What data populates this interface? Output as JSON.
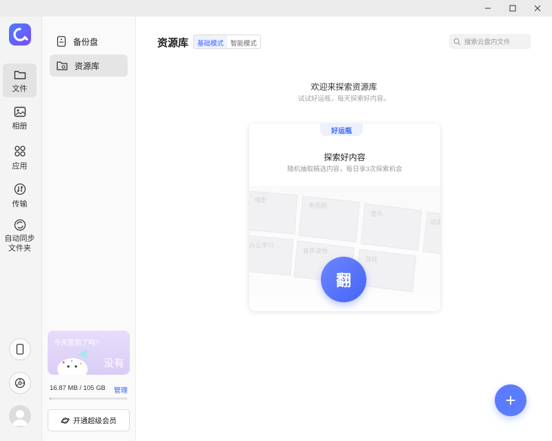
{
  "window": {
    "min_icon": "minimize-icon",
    "max_icon": "maximize-icon",
    "close_icon": "close-icon"
  },
  "rail": {
    "items": [
      {
        "label": "文件",
        "icon": "folder-icon",
        "active": true
      },
      {
        "label": "相册",
        "icon": "photo-icon"
      },
      {
        "label": "应用",
        "icon": "apps-icon"
      },
      {
        "label": "传输",
        "icon": "transfer-icon"
      },
      {
        "label": "自动同步\n文件夹",
        "icon": "sync-icon"
      }
    ]
  },
  "sidebar": {
    "items": [
      {
        "label": "备份盘",
        "icon": "backup-drive-icon"
      },
      {
        "label": "资源库",
        "icon": "library-folder-icon",
        "active": true
      }
    ],
    "promo": {
      "text": "今天签到了吗?",
      "badge": "没有"
    },
    "storage": {
      "text": "16.87 MB / 105 GB",
      "manage": "管理",
      "used_fraction": 0.0002
    },
    "vip_button": "开通超级会员"
  },
  "main": {
    "title": "资源库",
    "modes": [
      "基础模式",
      "智能模式"
    ],
    "search_placeholder": "搜索云盘内文件",
    "welcome_title": "欢迎来探索资源库",
    "welcome_sub": "试试好运瓶，每天探索好内容。",
    "card": {
      "tag": "好运瓶",
      "title": "探索好内容",
      "subtitle": "随机抽取精选内容，每日享3次探索机会",
      "bg_labels": [
        "电影",
        "电视剧",
        "音乐",
        "动漫",
        "办公学习",
        "有声读物",
        "游戏"
      ],
      "flip_label": "翻"
    },
    "fab_label": "+"
  },
  "colors": {
    "accent": "#3a66ff",
    "fab": "#5b7cff"
  }
}
